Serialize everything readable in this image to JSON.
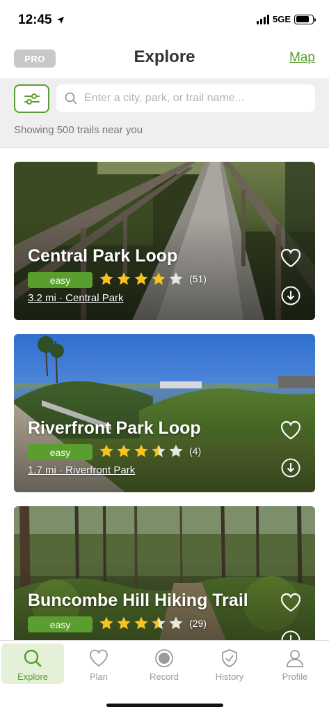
{
  "status_bar": {
    "time": "12:45",
    "network": "5GE"
  },
  "header": {
    "pro_label": "PRO",
    "title": "Explore",
    "map_link": "Map"
  },
  "search": {
    "placeholder": "Enter a city, park, or trail name...",
    "result_count": "Showing 500 trails near you"
  },
  "trails": [
    {
      "name": "Central Park Loop",
      "difficulty": "easy",
      "rating": 4,
      "reviews": "(51)",
      "meta": "3.2 mi · Central Park"
    },
    {
      "name": "Riverfront Park Loop",
      "difficulty": "easy",
      "rating": 3.5,
      "reviews": "(4)",
      "meta": "1.7 mi · Riverfront Park"
    },
    {
      "name": "Buncombe Hill Hiking Trail",
      "difficulty": "easy",
      "rating": 3.5,
      "reviews": "(29)",
      "meta": ""
    }
  ],
  "tabs": [
    {
      "label": "Explore",
      "icon": "search-icon",
      "active": true
    },
    {
      "label": "Plan",
      "icon": "heart-icon",
      "active": false
    },
    {
      "label": "Record",
      "icon": "record-icon",
      "active": false
    },
    {
      "label": "History",
      "icon": "shield-check-icon",
      "active": false
    },
    {
      "label": "Profile",
      "icon": "person-icon",
      "active": false
    }
  ],
  "colors": {
    "accent": "#5a9e2f",
    "star": "#f7c31f",
    "star_empty": "#e8e8e8"
  }
}
